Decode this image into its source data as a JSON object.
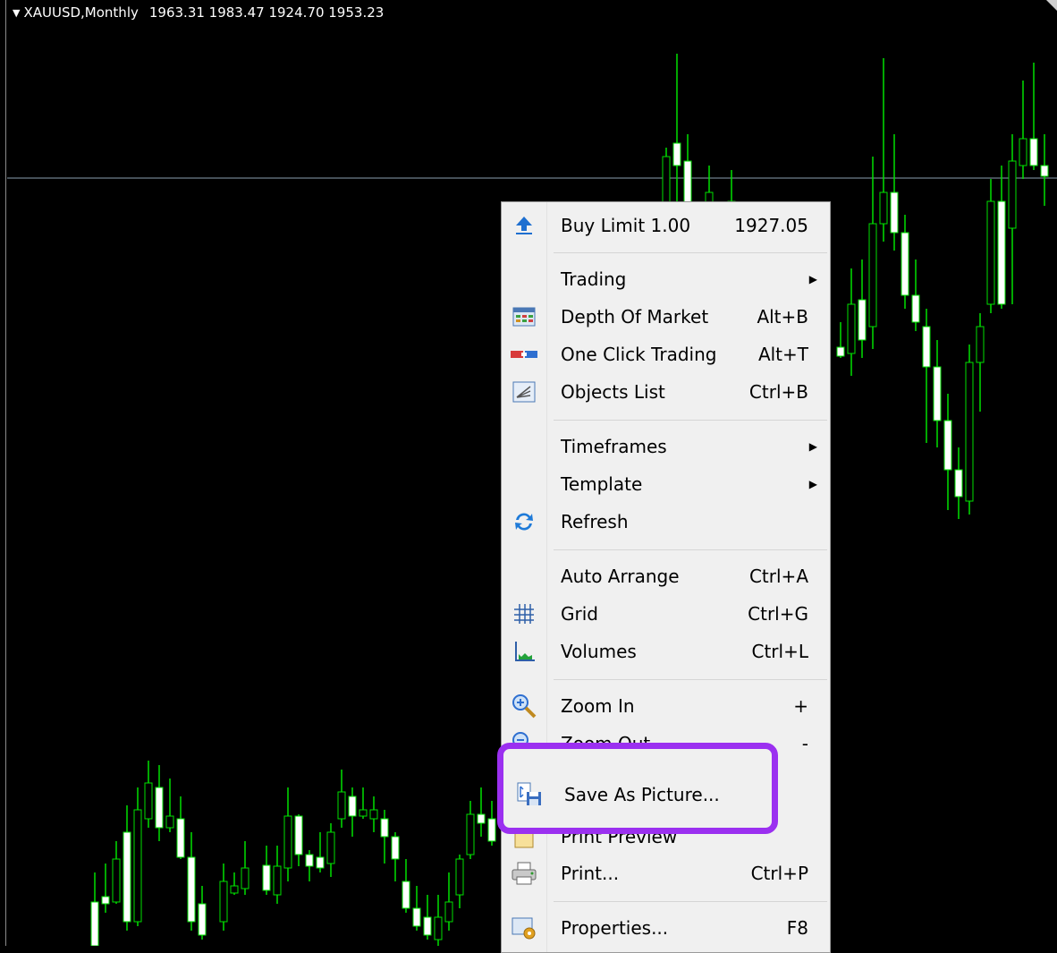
{
  "chart": {
    "symbol": "XAUUSD,Monthly",
    "ohlc": "1963.31 1983.47 1924.70 1953.23",
    "colors": {
      "background": "#000000",
      "bull": "#00e000",
      "body": "#ffffff",
      "crosshair": "#8aa0b0"
    }
  },
  "menu": {
    "items": [
      {
        "id": "buy-limit",
        "icon": "blue-up-arrow-icon",
        "label": "Buy Limit 1.00",
        "shortcut": "1927.05"
      },
      {
        "id": "trading",
        "label": "Trading",
        "submenu": true
      },
      {
        "id": "depth-of-market",
        "icon": "depth-of-market-icon",
        "label": "Depth Of Market",
        "shortcut": "Alt+B"
      },
      {
        "id": "one-click-trading",
        "icon": "one-click-trading-icon",
        "label": "One Click Trading",
        "shortcut": "Alt+T"
      },
      {
        "id": "objects-list",
        "icon": "objects-list-icon",
        "label": "Objects List",
        "shortcut": "Ctrl+B"
      },
      {
        "id": "timeframes",
        "label": "Timeframes",
        "submenu": true
      },
      {
        "id": "template",
        "label": "Template",
        "submenu": true
      },
      {
        "id": "refresh",
        "icon": "refresh-icon",
        "label": "Refresh"
      },
      {
        "id": "auto-arrange",
        "label": "Auto Arrange",
        "shortcut": "Ctrl+A"
      },
      {
        "id": "grid",
        "icon": "grid-icon",
        "label": "Grid",
        "shortcut": "Ctrl+G"
      },
      {
        "id": "volumes",
        "icon": "volumes-icon",
        "label": "Volumes",
        "shortcut": "Ctrl+L"
      },
      {
        "id": "zoom-in",
        "icon": "zoom-in-icon",
        "label": "Zoom In",
        "shortcut": "+"
      },
      {
        "id": "zoom-out",
        "icon": "zoom-out-icon",
        "label": "Zoom Out",
        "shortcut": "-"
      },
      {
        "id": "save-as-picture",
        "icon": "save-as-picture-icon",
        "label": "Save As Picture..."
      },
      {
        "id": "print-preview",
        "icon": "print-preview-icon",
        "label": "Print Preview"
      },
      {
        "id": "print",
        "icon": "printer-icon",
        "label": "Print...",
        "shortcut": "Ctrl+P"
      },
      {
        "id": "properties",
        "icon": "properties-icon",
        "label": "Properties...",
        "shortcut": "F8"
      }
    ],
    "highlight_color": "#9b30f0"
  }
}
